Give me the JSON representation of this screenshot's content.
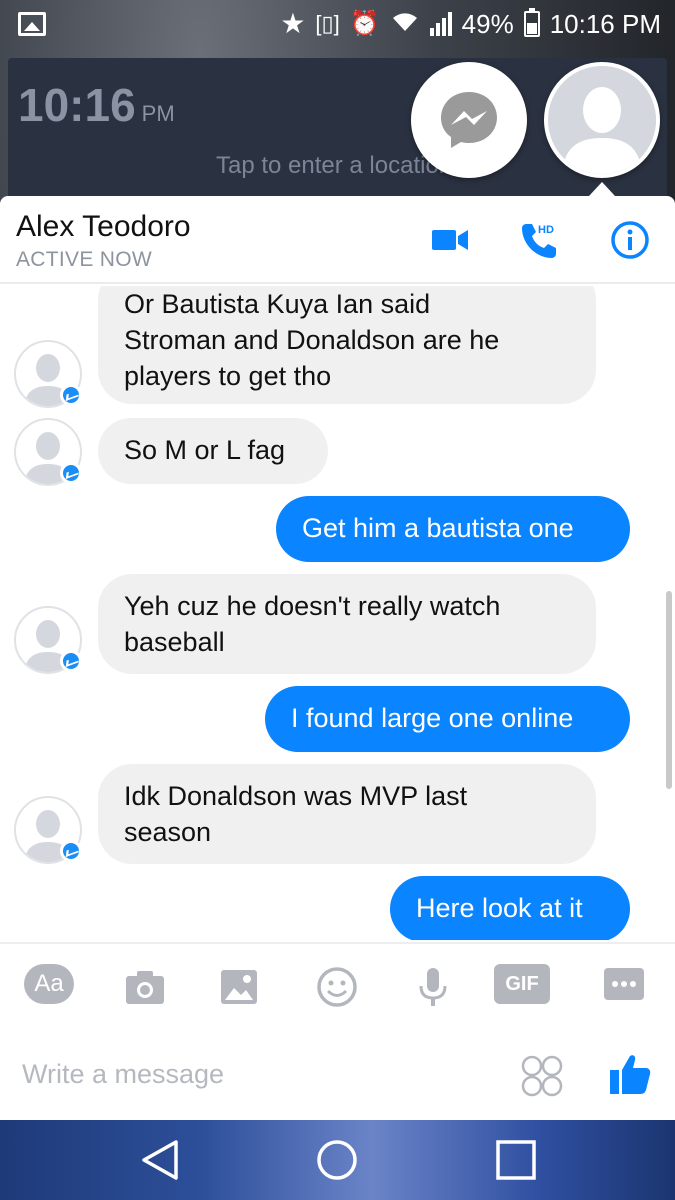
{
  "status_bar": {
    "battery": "49%",
    "time": "10:16 PM"
  },
  "lock_screen": {
    "time": "10:16",
    "ampm": "PM",
    "location_prompt": "Tap to enter a location"
  },
  "header": {
    "contact_name": "Alex Teodoro",
    "status": "ACTIVE NOW",
    "call_badge": "HD"
  },
  "messages": [
    {
      "direction": "in",
      "text": "Or Bautista Kuya Ian said\nStroman and Donaldson are he\nplayers to get tho"
    },
    {
      "direction": "in",
      "text": "So M or L fag"
    },
    {
      "direction": "out",
      "text": "Get him a bautista one"
    },
    {
      "direction": "in",
      "text": "Yeh cuz he doesn't really watch\nbaseball"
    },
    {
      "direction": "out",
      "text": "I found large one online"
    },
    {
      "direction": "in",
      "text": "Idk Donaldson was MVP last\nseason"
    },
    {
      "direction": "out",
      "text": "Here look at it"
    }
  ],
  "toolbar": {
    "text_label": "Aa",
    "gif_label": "GIF",
    "icons": [
      "text-format-icon",
      "camera-icon",
      "gallery-icon",
      "emoji-icon",
      "microphone-icon",
      "gif-icon",
      "more-icon"
    ]
  },
  "composer": {
    "placeholder": "Write a message"
  },
  "colors": {
    "accent": "#0a84ff",
    "incoming_bubble": "#f0f0f0",
    "icon_gray": "#b3b7bd"
  }
}
